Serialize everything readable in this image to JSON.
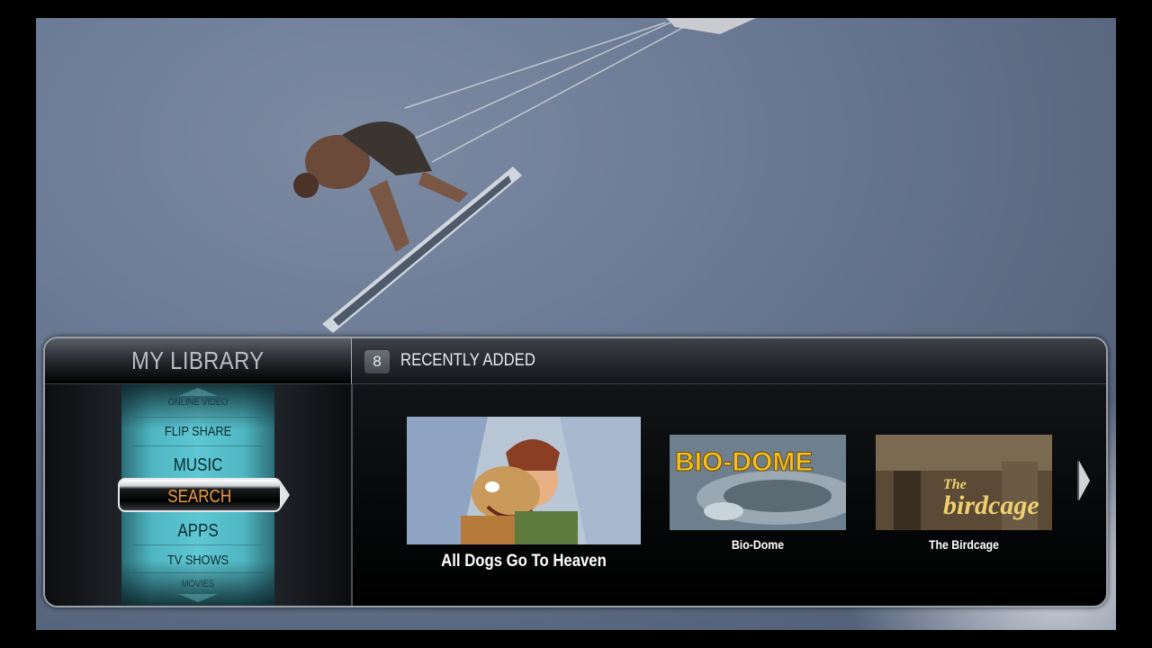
{
  "library": {
    "title": "MY LIBRARY",
    "menu_items": [
      "ONLINE VIDEO",
      "FLIP SHARE",
      "MUSIC",
      "SEARCH",
      "APPS",
      "TV SHOWS",
      "MOVIES"
    ],
    "selected": "SEARCH"
  },
  "recent": {
    "count": "8",
    "label": "RECENTLY ADDED",
    "items": [
      {
        "title": "All Dogs Go To Heaven"
      },
      {
        "title": "Bio-Dome",
        "poster_text": "BIO-DOME"
      },
      {
        "title": "The Birdcage",
        "poster_text_small": "The",
        "poster_text_large": "birdcage"
      }
    ]
  },
  "colors": {
    "menu_teal": "#5ec7d2",
    "selected_text": "#f09a3e",
    "panel_bg": "#050607"
  },
  "icons": {
    "next": "chevron-right-icon",
    "scroll_up": "arrow-up-icon",
    "scroll_down": "arrow-down-icon"
  }
}
